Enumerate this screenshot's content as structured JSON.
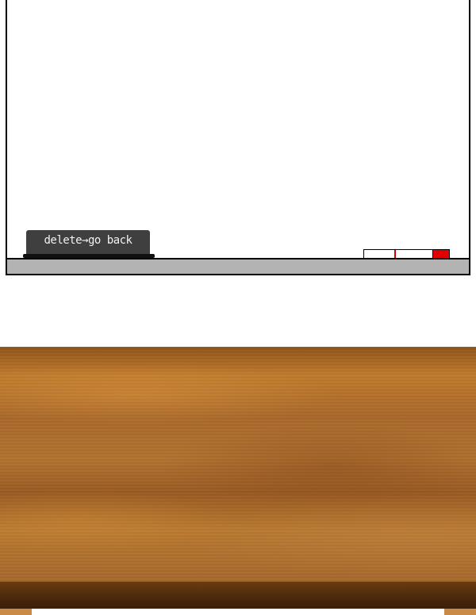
{
  "whiteboard": {
    "eraser": {
      "label": "delete→go back",
      "color": "#3f3f3f"
    },
    "marker": {
      "cap_color": "#e00000",
      "band_color": "#d40000"
    },
    "tray_color": "#b3b3b3"
  },
  "desk": {
    "wood_color": "#b37330",
    "edge_color": "#4a280b"
  }
}
